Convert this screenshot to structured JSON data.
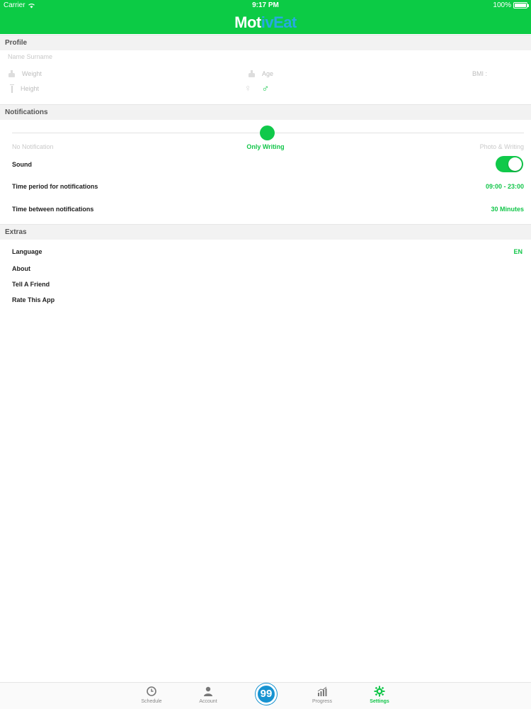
{
  "status_bar": {
    "carrier": "Carrier",
    "time": "9:17 PM",
    "battery": "100%"
  },
  "brand": {
    "part1": "Mot",
    "part2": "ivEat"
  },
  "profile": {
    "header": "Profile",
    "name_placeholder": "Name Surname",
    "weight_label": "Weight",
    "age_label": "Age",
    "bmi_label": "BMI :",
    "height_label": "Height",
    "female_symbol": "♀",
    "male_symbol": "♂"
  },
  "notifications": {
    "header": "Notifications",
    "options": [
      "No Notification",
      "Only Writing",
      "Photo & Writing"
    ],
    "selected_index": 1,
    "sound_label": "Sound",
    "sound_on": true,
    "time_period_label": "Time period for notifications",
    "time_period_value": "09:00 - 23:00",
    "time_between_label": "Time between notifications",
    "time_between_value": "30 Minutes"
  },
  "extras": {
    "header": "Extras",
    "language_label": "Language",
    "language_value": "EN",
    "about_label": "About",
    "tell_friend_label": "Tell A Friend",
    "rate_label": "Rate This App"
  },
  "tabbar": {
    "schedule": "Schedule",
    "account": "Account",
    "center": "99",
    "progress": "Progress",
    "settings": "Settings"
  },
  "colors": {
    "brand_green": "#0ccb45",
    "accent_blue": "#27a9e1"
  }
}
